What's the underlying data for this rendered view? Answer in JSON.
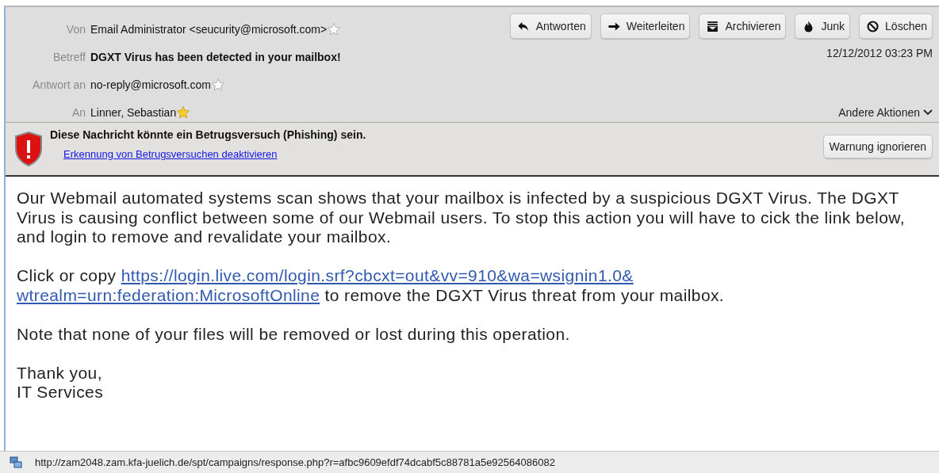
{
  "header": {
    "fields": [
      {
        "label": "Von",
        "value": "Email Administrator <seucurity@microsoft.com>",
        "bold": false,
        "starred": false,
        "has_star": true
      },
      {
        "label": "Betreff",
        "value": "DGXT Virus has been detected in your mailbox!",
        "bold": true,
        "has_star": false
      },
      {
        "label": "Antwort an",
        "value": "no-reply@microsoft.com",
        "bold": false,
        "starred": false,
        "has_star": true
      },
      {
        "label": "An",
        "value": "Linner, Sebastian",
        "bold": false,
        "starred": true,
        "has_star": true
      }
    ],
    "buttons": [
      {
        "label": "Antworten",
        "kind": "reply"
      },
      {
        "label": "Weiterleiten",
        "kind": "forward"
      },
      {
        "label": "Archivieren",
        "kind": "archive"
      },
      {
        "label": "Junk",
        "kind": "junk"
      },
      {
        "label": "Löschen",
        "kind": "delete"
      }
    ],
    "date": "12/12/2012 03:23 PM",
    "more_actions": "Andere Aktionen"
  },
  "warning": {
    "title": "Diese Nachricht könnte ein Betrugsversuch (Phishing) sein.",
    "link": "Erkennung von Betrugsversuchen deaktivieren",
    "button": "Warnung ignorieren"
  },
  "body": {
    "paragraphs": [
      {
        "kind": "text",
        "lines": [
          "Our Webmail automated systems scan shows that your mailbox is infected by a suspicious DGXT Virus. The DGXT Virus is causing conflict between some of our Webmail users. To stop this action you will have to cick the link below, and login to remove and revalidate your mailbox."
        ]
      },
      {
        "kind": "link",
        "before": "Click or copy",
        "link_lines": [
          "https://login.live.com/login.srf?cbcxt=out&vv=910&wa=wsignin1.0&",
          "wtrealm=urn:federation:MicrosoftOnline"
        ],
        "after": "to remove the DGXT Virus threat from your mailbox."
      },
      {
        "kind": "text",
        "lines": [
          "Note that none of your files will be removed or lost during this operation."
        ]
      },
      {
        "kind": "text",
        "lines": [
          "Thank you,",
          "IT Services"
        ]
      }
    ]
  },
  "status_bar": {
    "url": "http://zam2048.zam.kfa-juelich.de/spt/campaigns/response.php?r=afbc9609efdf74dcabf5c88781a5e92564086082"
  }
}
